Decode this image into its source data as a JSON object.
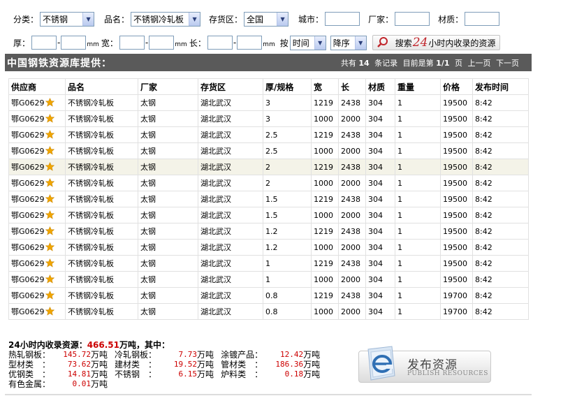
{
  "filters": {
    "category_label": "分类：",
    "category_value": "不锈钢",
    "product_label": "品名：",
    "product_value": "不锈钢冷轧板",
    "region_label": "存货区：",
    "region_value": "全国",
    "city_label": "城市：",
    "maker_label": "厂家：",
    "material_label": "材质：",
    "thickness_label": "厚：",
    "width_label": "宽：",
    "length_label": "长：",
    "unit_mm": "mm",
    "sort_label": "按",
    "sort_field": "时间",
    "sort_order": "降序",
    "search_prefix": "搜索",
    "search_number": "24",
    "search_suffix": "小时内收录的资源"
  },
  "titlebar": {
    "title": "中国钢铁资源库提供：",
    "total_prefix": "共有",
    "total": "14",
    "total_suffix": "条记录",
    "page_prefix": "目前是第",
    "page_current": "1",
    "page_total": "/1",
    "page_suffix": "页",
    "prev": "上一页",
    "next": "下一页"
  },
  "table": {
    "headers": [
      "供应商",
      "品名",
      "厂家",
      "存货区",
      "厚/规格",
      "宽",
      "长",
      "材质",
      "重量",
      "价格",
      "发布时间"
    ],
    "rows": [
      [
        "鄂G0629",
        "不锈钢冷轧板",
        "太钢",
        "湖北武汉",
        "3",
        "1219",
        "2438",
        "304",
        "1",
        "19500",
        "8:42"
      ],
      [
        "鄂G0629",
        "不锈钢冷轧板",
        "太钢",
        "湖北武汉",
        "3",
        "1000",
        "2000",
        "304",
        "1",
        "19500",
        "8:42"
      ],
      [
        "鄂G0629",
        "不锈钢冷轧板",
        "太钢",
        "湖北武汉",
        "2.5",
        "1219",
        "2438",
        "304",
        "1",
        "19500",
        "8:42"
      ],
      [
        "鄂G0629",
        "不锈钢冷轧板",
        "太钢",
        "湖北武汉",
        "2.5",
        "1000",
        "2000",
        "304",
        "1",
        "19500",
        "8:42"
      ],
      [
        "鄂G0629",
        "不锈钢冷轧板",
        "太钢",
        "湖北武汉",
        "2",
        "1219",
        "2438",
        "304",
        "1",
        "19500",
        "8:42"
      ],
      [
        "鄂G0629",
        "不锈钢冷轧板",
        "太钢",
        "湖北武汉",
        "2",
        "1000",
        "2000",
        "304",
        "1",
        "19500",
        "8:42"
      ],
      [
        "鄂G0629",
        "不锈钢冷轧板",
        "太钢",
        "湖北武汉",
        "1.5",
        "1219",
        "2438",
        "304",
        "1",
        "19500",
        "8:42"
      ],
      [
        "鄂G0629",
        "不锈钢冷轧板",
        "太钢",
        "湖北武汉",
        "1.5",
        "1000",
        "2000",
        "304",
        "1",
        "19500",
        "8:42"
      ],
      [
        "鄂G0629",
        "不锈钢冷轧板",
        "太钢",
        "湖北武汉",
        "1.2",
        "1219",
        "2438",
        "304",
        "1",
        "19500",
        "8:42"
      ],
      [
        "鄂G0629",
        "不锈钢冷轧板",
        "太钢",
        "湖北武汉",
        "1.2",
        "1000",
        "2000",
        "304",
        "1",
        "19500",
        "8:42"
      ],
      [
        "鄂G0629",
        "不锈钢冷轧板",
        "太钢",
        "湖北武汉",
        "1",
        "1219",
        "2438",
        "304",
        "1",
        "19500",
        "8:42"
      ],
      [
        "鄂G0629",
        "不锈钢冷轧板",
        "太钢",
        "湖北武汉",
        "1",
        "1000",
        "2000",
        "304",
        "1",
        "19500",
        "8:42"
      ],
      [
        "鄂G0629",
        "不锈钢冷轧板",
        "太钢",
        "湖北武汉",
        "0.8",
        "1219",
        "2438",
        "304",
        "1",
        "19700",
        "8:42"
      ],
      [
        "鄂G0629",
        "不锈钢冷轧板",
        "太钢",
        "湖北武汉",
        "0.8",
        "1000",
        "2000",
        "304",
        "1",
        "19700",
        "8:42"
      ]
    ],
    "highlighted_row": 4,
    "star_color": "#f0a500"
  },
  "summary": {
    "head_prefix": "24小时内收录资源：",
    "head_value": "466.51",
    "head_suffix": "万吨，其中：",
    "unit": "万吨",
    "items": [
      [
        {
          "name": "热轧钢板：",
          "value": "145.72"
        },
        {
          "name": "冷轧钢板：",
          "value": "7.73"
        },
        {
          "name": "涂镀产品：",
          "value": "12.42"
        }
      ],
      [
        {
          "name": "型材类　：",
          "value": "73.62"
        },
        {
          "name": "建材类　：",
          "value": "19.52"
        },
        {
          "name": "管材类　：",
          "value": "186.36"
        }
      ],
      [
        {
          "name": "优钢类　：",
          "value": "14.81"
        },
        {
          "name": "不锈钢　：",
          "value": "6.15"
        },
        {
          "name": "炉料类　：",
          "value": "0.18"
        }
      ],
      [
        {
          "name": "有色金属：",
          "value": "0.01"
        }
      ]
    ]
  },
  "publish": {
    "title": "发布资源",
    "subtitle": "PUBLISH RESOURCES"
  },
  "colors": {
    "titlebar_bg": "#5a5a5a",
    "accent_red": "#c00000",
    "highlight_row": "#f4f3e8"
  }
}
